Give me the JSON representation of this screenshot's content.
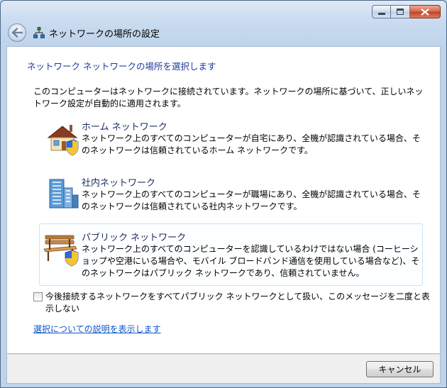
{
  "window": {
    "title": "ネットワークの場所の設定",
    "controls": {
      "minimize": "minimize-icon",
      "maximize": "maximize-icon",
      "close": "close-icon"
    }
  },
  "nav": {
    "back_icon": "back-arrow-icon",
    "title_icon": "network-icon"
  },
  "main": {
    "section_title": "ネットワーク ネットワークの場所を選択します",
    "intro": "このコンピューターはネットワークに接続されています。ネットワークの場所に基づいて、正しいネットワーク設定が自動的に適用されます。",
    "options": [
      {
        "title": "ホーム ネットワーク",
        "description": "ネットワーク上のすべてのコンピューターが自宅にあり、全機が認識されている場合、そのネットワークは信頼されているホーム ネットワークです。",
        "icon": "home-network-icon"
      },
      {
        "title": "社内ネットワーク",
        "description": "ネットワーク上のすべてのコンピューターが職場にあり、全機が認識されている場合、そのネットワークは信頼されている社内ネットワークです。",
        "icon": "work-network-icon"
      },
      {
        "title": "パブリック ネットワーク",
        "description": "ネットワーク上のすべてのコンピューターを認識しているわけではない場合 (コーヒーショップや空港にいる場合や、モバイル ブロードバンド通信を使用している場合など)、そのネットワークはパブリック ネットワークであり、信頼されていません。",
        "icon": "public-network-icon"
      }
    ],
    "checkbox": {
      "label": "今後接続するネットワークをすべてパブリック ネットワークとして扱い、このメッセージを二度と表示しない",
      "checked": false
    },
    "help_link": "選択についての説明を表示します"
  },
  "footer": {
    "cancel_label": "キャンセル"
  },
  "colors": {
    "section_title": "#1e3c9c",
    "link": "#0a56c8",
    "highlight_border": "#c5e6f5"
  }
}
